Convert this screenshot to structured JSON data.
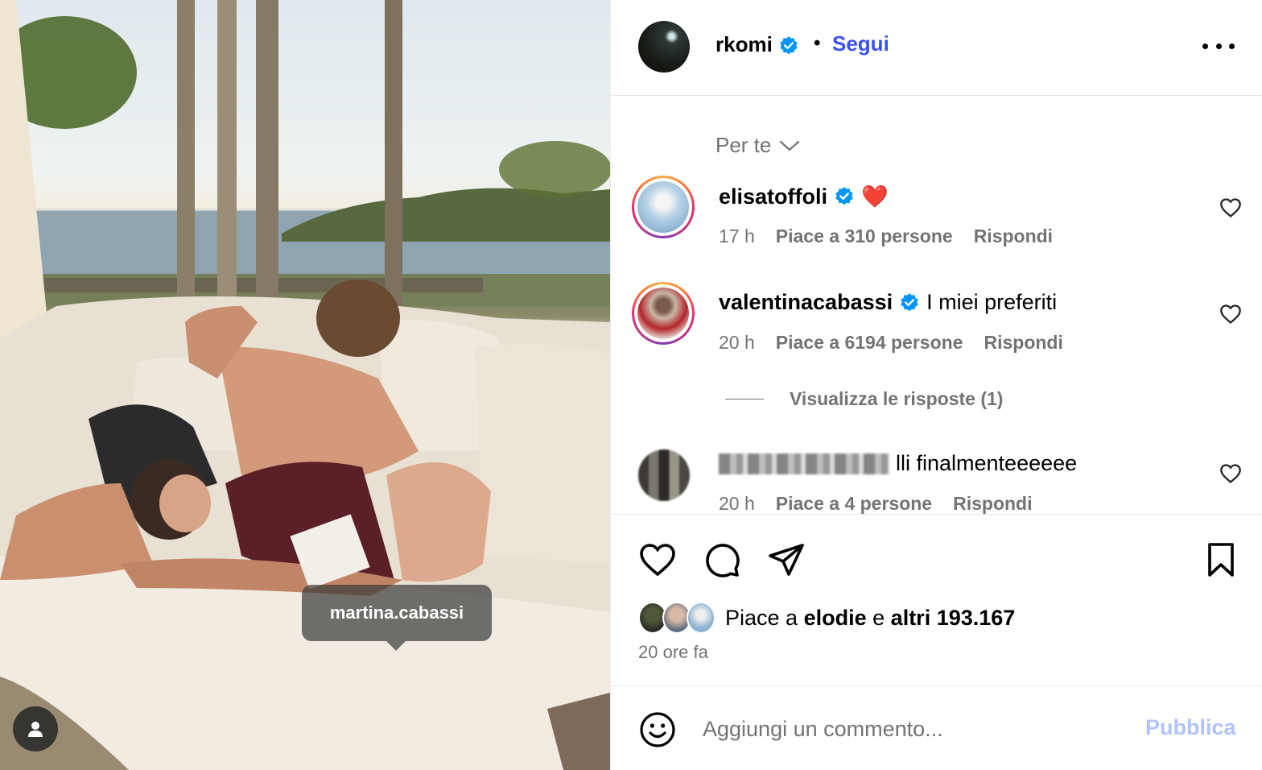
{
  "photo": {
    "tag_label": "martina.cabassi",
    "tag_icon": "user-tag-icon"
  },
  "post_header": {
    "username": "rkomi",
    "separator": "•",
    "follow_label": "Segui",
    "more_icon": "more-horizontal-icon"
  },
  "comments_section": {
    "sort_label": "Per te",
    "items": [
      {
        "username": "elisatoffoli",
        "text": "❤️",
        "time": "17 h",
        "likes": "Piace a 310 persone",
        "reply": "Rispondi"
      },
      {
        "username": "valentinacabassi",
        "text": "I miei preferiti",
        "time": "20 h",
        "likes": "Piace a 6194 persone",
        "reply": "Rispondi"
      },
      {
        "username": "",
        "text": "lli finalmenteeeeee",
        "time": "20 h",
        "likes": "Piace a 4 persone",
        "reply": "Rispondi"
      }
    ],
    "view_replies": "Visualizza le risposte (1)"
  },
  "actions": {
    "like_icon": "heart-icon",
    "comment_icon": "comment-icon",
    "share_icon": "send-icon",
    "save_icon": "bookmark-icon"
  },
  "likes_summary": {
    "prefix": "Piace a",
    "first_user": "elodie",
    "connector": "e",
    "others": "altri 193.167",
    "time_ago": "20 ore fa"
  },
  "add_comment": {
    "placeholder": "Aggiungi un commento...",
    "publish_label": "Pubblica",
    "emoji_icon": "emoji-icon"
  },
  "colors": {
    "link_blue": "#3a52f4",
    "verified_blue": "#0095f6",
    "muted": "#737373",
    "publish_disabled": "#b3c2fb"
  }
}
